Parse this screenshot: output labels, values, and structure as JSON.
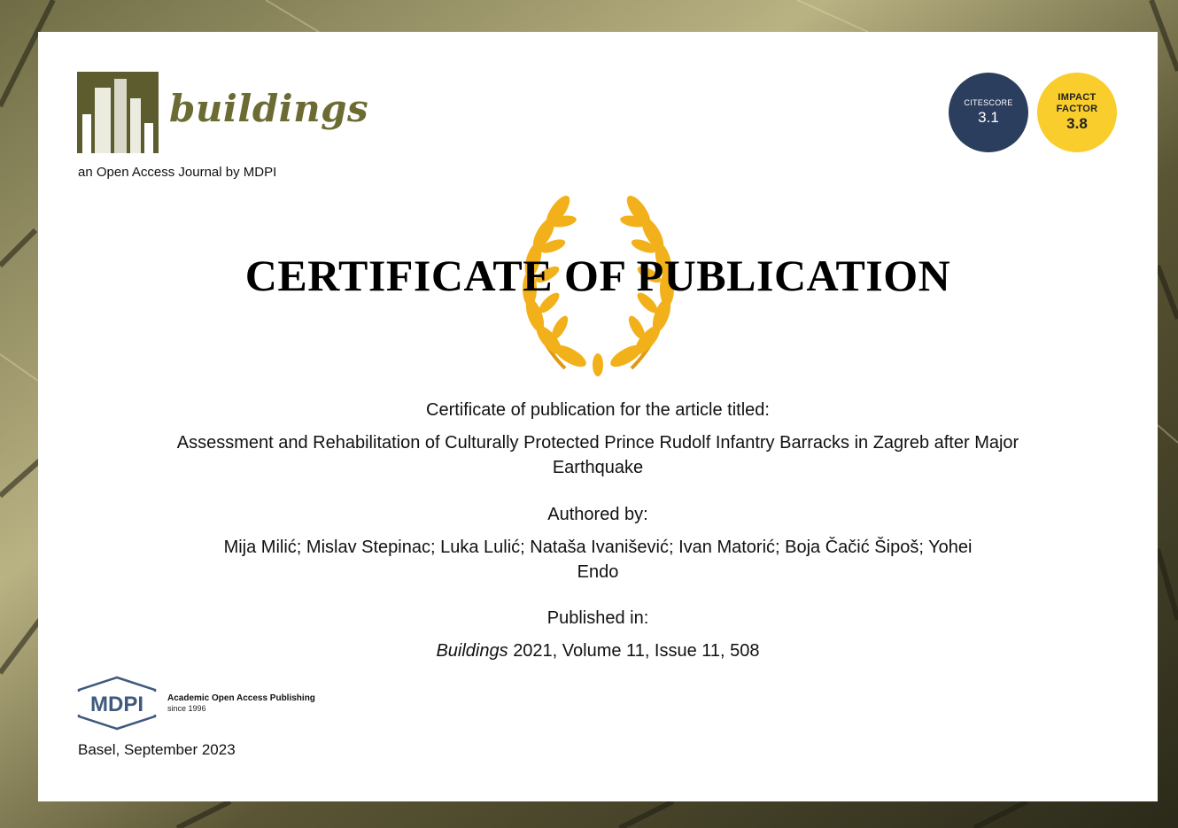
{
  "header": {
    "journal_name": "buildings",
    "tagline": "an Open Access Journal by MDPI"
  },
  "badges": {
    "citescore_label": "CITESCORE",
    "citescore_value": "3.1",
    "impact_factor_label": "IMPACT FACTOR",
    "impact_factor_value": "3.8"
  },
  "certificate": {
    "title": "CERTIFICATE OF PUBLICATION",
    "intro": "Certificate of publication for the article titled:",
    "article_title": "Assessment and Rehabilitation of Culturally Protected Prince Rudolf Infantry Barracks in Zagreb after Major Earthquake",
    "authored_by_label": "Authored by:",
    "authors": "Mija Milić; Mislav Stepinac; Luka Lulić; Nataša Ivanišević; Ivan Matorić; Boja Čačić Šipoš; Yohei Endo",
    "published_in_label": "Published in:",
    "journal_italic": "Buildings",
    "citation_rest": "2021, Volume 11, Issue 11, 508"
  },
  "footer": {
    "publisher_logo_text": "MDPI",
    "publisher_tagline": "Academic Open Access Publishing",
    "publisher_since": "since 1996",
    "place_date": "Basel, September 2023"
  },
  "colors": {
    "journal_olive": "#6b6b33",
    "citescore_navy": "#2c3e5e",
    "impact_yellow": "#f9cd2c",
    "wreath_gold": "#f2b11a",
    "mdpi_blue": "#3f5a7e"
  }
}
